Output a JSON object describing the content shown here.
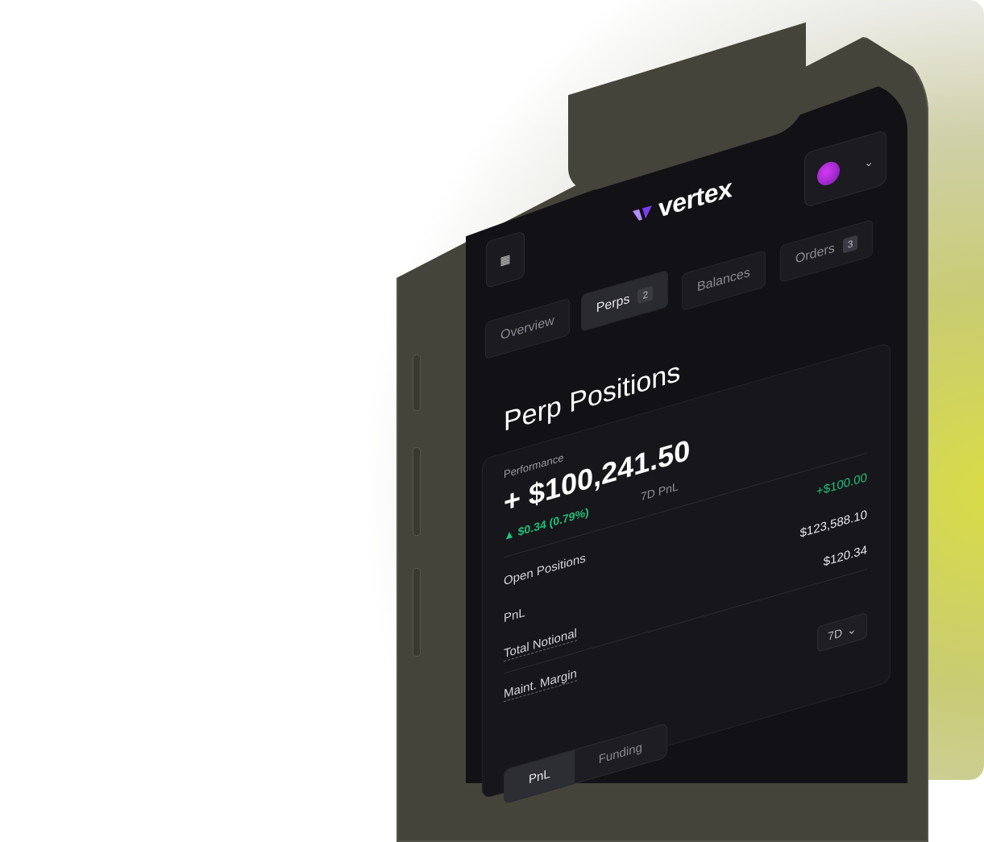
{
  "brand": {
    "name": "vertex",
    "accent": "#9b59ff"
  },
  "header": {
    "menu_icon": "grid-icon",
    "account_chevron": "chevron-down-icon"
  },
  "tabs": [
    {
      "label": "Overview",
      "count": ""
    },
    {
      "label": "Perps",
      "count": "2"
    },
    {
      "label": "Balances",
      "count": ""
    },
    {
      "label": "Orders",
      "count": "3"
    }
  ],
  "page": {
    "title": "Perp Positions"
  },
  "performance": {
    "label": "Performance",
    "value": "+ $100,241.50",
    "change": "▲ $0.34 (0.79%)",
    "change_suffix": "7D PnL"
  },
  "stats": {
    "open_positions": {
      "label": "Open Positions",
      "value": "+$100.00"
    },
    "pnl": {
      "label": "PnL",
      "value": "$123,588.10"
    },
    "total_notional": {
      "label": "Total Notional",
      "value": "$120.34"
    },
    "maint_margin": {
      "label": "Maint. Margin",
      "value": ""
    }
  },
  "range": {
    "selected": "7D"
  },
  "chart_tabs": [
    {
      "label": "PnL",
      "active": true
    },
    {
      "label": "Funding",
      "active": false
    }
  ],
  "colors": {
    "positive": "#1fc17b",
    "screen_bg": "#121216",
    "phone_frame": "#45443a"
  }
}
